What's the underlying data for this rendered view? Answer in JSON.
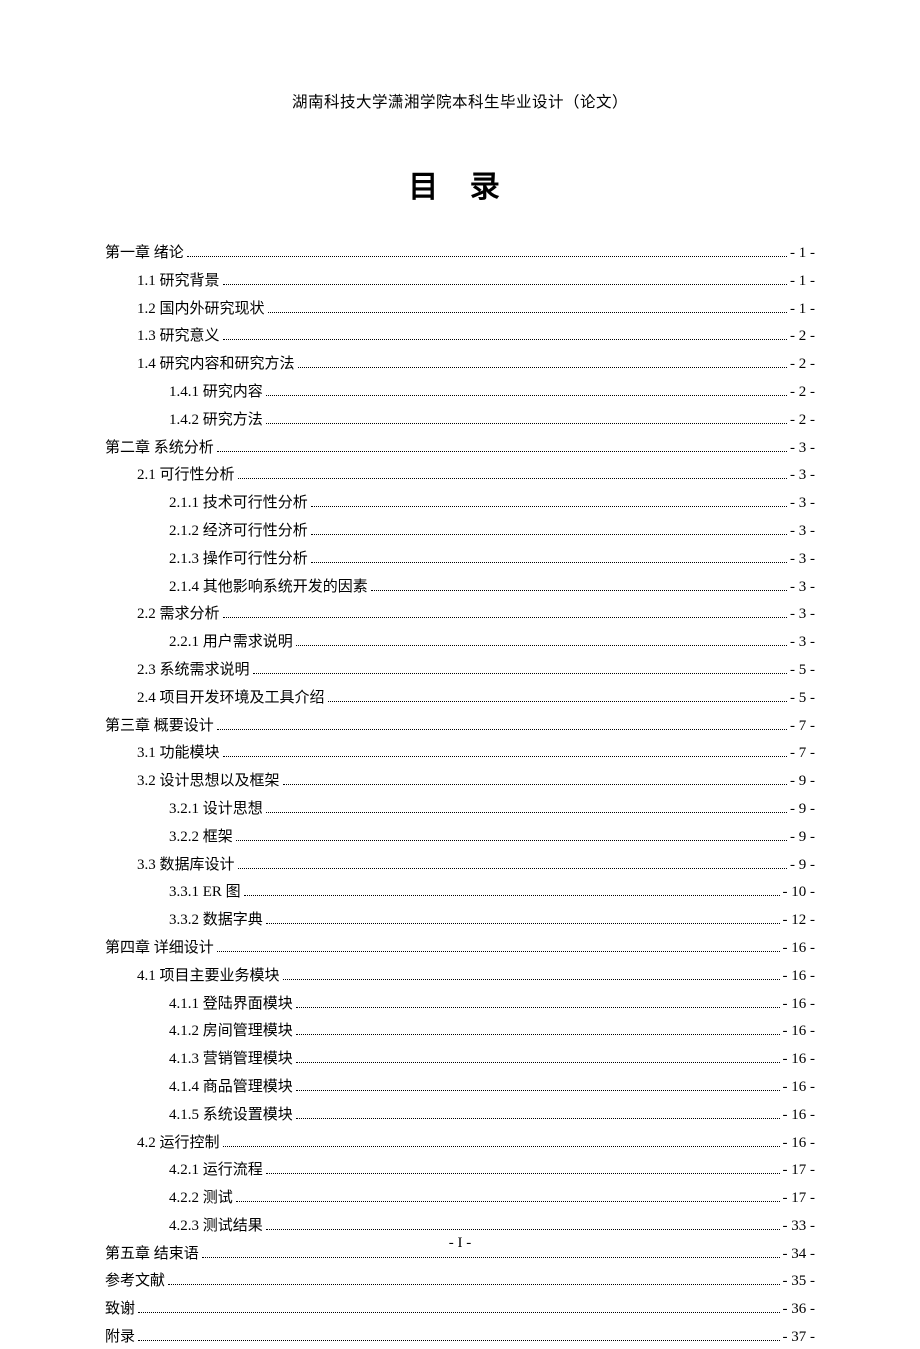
{
  "header": "湖南科技大学潇湘学院本科生毕业设计（论文）",
  "title": "目 录",
  "footer": "- I -",
  "toc": [
    {
      "level": 0,
      "label": "第一章  绪论",
      "page": "- 1 -"
    },
    {
      "level": 1,
      "label": "1.1 研究背景",
      "page": "- 1 -"
    },
    {
      "level": 1,
      "label": "1.2 国内外研究现状",
      "page": "- 1 -"
    },
    {
      "level": 1,
      "label": "1.3 研究意义",
      "page": "- 2 -"
    },
    {
      "level": 1,
      "label": "1.4 研究内容和研究方法",
      "page": "- 2 -"
    },
    {
      "level": 2,
      "label": "1.4.1 研究内容",
      "page": "- 2 -"
    },
    {
      "level": 2,
      "label": "1.4.2 研究方法",
      "page": "- 2 -"
    },
    {
      "level": 0,
      "label": "第二章  系统分析",
      "page": "- 3 -"
    },
    {
      "level": 1,
      "label": "2.1 可行性分析",
      "page": "- 3 -"
    },
    {
      "level": 2,
      "label": "2.1.1  技术可行性分析",
      "page": "- 3 -"
    },
    {
      "level": 2,
      "label": "2.1.2  经济可行性分析",
      "page": "- 3 -"
    },
    {
      "level": 2,
      "label": "2.1.3  操作可行性分析",
      "page": "- 3 -"
    },
    {
      "level": 2,
      "label": "2.1.4  其他影响系统开发的因素",
      "page": "- 3 -"
    },
    {
      "level": 1,
      "label": "2.2  需求分析",
      "page": "- 3 -"
    },
    {
      "level": 2,
      "label": "2.2.1  用户需求说明",
      "page": "- 3 -"
    },
    {
      "level": 1,
      "label": "2.3  系统需求说明",
      "page": "- 5 -"
    },
    {
      "level": 1,
      "label": "2.4 项目开发环境及工具介绍",
      "page": "- 5 -"
    },
    {
      "level": 0,
      "label": "第三章  概要设计",
      "page": "- 7 -"
    },
    {
      "level": 1,
      "label": "3.1 功能模块",
      "page": "- 7 -"
    },
    {
      "level": 1,
      "label": "3.2  设计思想以及框架",
      "page": "- 9 -"
    },
    {
      "level": 2,
      "label": "3.2.1 设计思想",
      "page": "- 9 -"
    },
    {
      "level": 2,
      "label": "3.2.2 框架",
      "page": "- 9 -"
    },
    {
      "level": 1,
      "label": "3.3 数据库设计",
      "page": "- 9 -"
    },
    {
      "level": 2,
      "label": "3.3.1 ER 图",
      "page": "- 10 -"
    },
    {
      "level": 2,
      "label": "3.3.2  数据字典",
      "page": "- 12 -"
    },
    {
      "level": 0,
      "label": "第四章  详细设计",
      "page": "- 16 -"
    },
    {
      "level": 1,
      "label": "4.1 项目主要业务模块",
      "page": "- 16 -"
    },
    {
      "level": 2,
      "label": "4.1.1 登陆界面模块",
      "page": "- 16 -"
    },
    {
      "level": 2,
      "label": "4.1.2 房间管理模块",
      "page": "- 16 -"
    },
    {
      "level": 2,
      "label": "4.1.3 营销管理模块",
      "page": "- 16 -"
    },
    {
      "level": 2,
      "label": "4.1.4 商品管理模块",
      "page": "- 16 -"
    },
    {
      "level": 2,
      "label": "4.1.5 系统设置模块",
      "page": "- 16 -"
    },
    {
      "level": 1,
      "label": "4.2 运行控制",
      "page": "- 16 -"
    },
    {
      "level": 2,
      "label": "4.2.1 运行流程",
      "page": "- 17 -"
    },
    {
      "level": 2,
      "label": "4.2.2  测试",
      "page": "- 17 -"
    },
    {
      "level": 2,
      "label": "4.2.3  测试结果",
      "page": "- 33 -"
    },
    {
      "level": 0,
      "label": "第五章  结束语",
      "page": "- 34 -"
    },
    {
      "level": 0,
      "label": "参考文献",
      "page": "- 35 -"
    },
    {
      "level": 0,
      "label": "致谢",
      "page": "- 36 -"
    },
    {
      "level": 0,
      "label": "附录",
      "page": "- 37 -"
    }
  ]
}
